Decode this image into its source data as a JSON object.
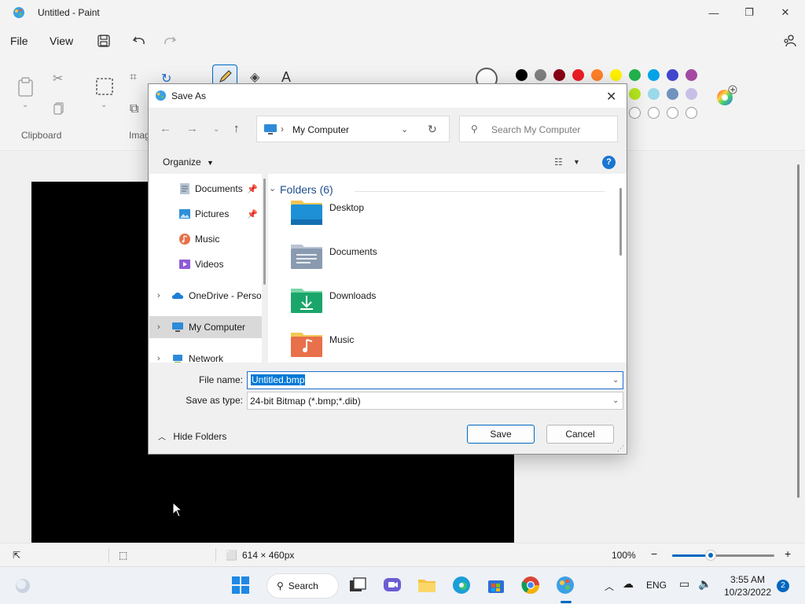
{
  "window": {
    "title": "Untitled - Paint",
    "controls": {
      "minimize": "—",
      "maximize": "❐",
      "close": "✕"
    }
  },
  "menu": {
    "file": "File",
    "view": "View"
  },
  "ribbon": {
    "groups": [
      {
        "label": "Clipboard"
      },
      {
        "label": "Imag"
      }
    ]
  },
  "palette": {
    "row1": [
      "#000000",
      "#7f7f7f",
      "#880015",
      "#ed1c24",
      "#ff7f27",
      "#fff200",
      "#22b14c",
      "#00a2e8",
      "#3f48cc",
      "#a349a4"
    ],
    "row2": [
      "#b5e61d",
      "#99d9ea",
      "#7092be",
      "#c8bfe7"
    ]
  },
  "dialog": {
    "title": "Save As",
    "address": {
      "location": "My Computer"
    },
    "search": {
      "placeholder": "Search My Computer"
    },
    "toolbar": {
      "organize": "Organize",
      "help": "?"
    },
    "nav_items": [
      {
        "label": "Documents",
        "icon": "documents-icon",
        "pinned": true
      },
      {
        "label": "Pictures",
        "icon": "pictures-icon",
        "pinned": true
      },
      {
        "label": "Music",
        "icon": "music-icon",
        "pinned": false
      },
      {
        "label": "Videos",
        "icon": "videos-icon",
        "pinned": false
      },
      {
        "label": "OneDrive - Perso",
        "icon": "onedrive-icon",
        "expandable": true
      },
      {
        "label": "My Computer",
        "icon": "computer-icon",
        "expandable": true,
        "selected": true
      },
      {
        "label": "Network",
        "icon": "network-icon",
        "expandable": true
      }
    ],
    "group_header": "Folders (6)",
    "folders": [
      {
        "name": "Desktop",
        "color": "#1e90d6"
      },
      {
        "name": "Documents",
        "color": "#8a9bb0"
      },
      {
        "name": "Downloads",
        "color": "#1aa66a"
      },
      {
        "name": "Music",
        "color": "#e8704a"
      }
    ],
    "file_name_label": "File name:",
    "file_name_value": "Untitled.bmp",
    "save_type_label": "Save as type:",
    "save_type_value": "24-bit Bitmap (*.bmp;*.dib)",
    "hide_folders": "Hide Folders",
    "save": "Save",
    "cancel": "Cancel"
  },
  "status": {
    "canvas_size": "614 × 460px",
    "zoom": "100%",
    "zoom_fraction": 0.38
  },
  "taskbar": {
    "search": "Search",
    "lang": "ENG",
    "time": "3:55 AM",
    "date": "10/23/2022",
    "notifications": "2"
  }
}
